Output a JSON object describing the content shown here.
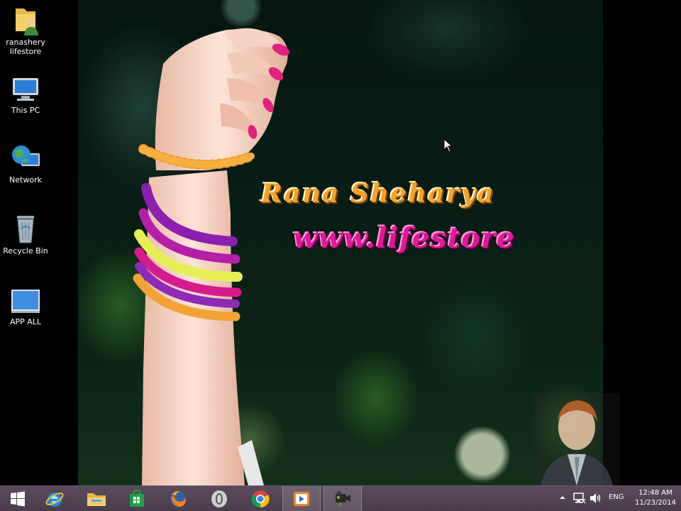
{
  "desktop": {
    "icons": [
      {
        "label": "ranashery\nlifestore",
        "icon": "user-folder-icon"
      },
      {
        "label": "This PC",
        "icon": "computer-icon"
      },
      {
        "label": "Network",
        "icon": "network-globe-icon"
      },
      {
        "label": "Recycle Bin",
        "icon": "recycle-bin-icon"
      },
      {
        "label": "APP ALL",
        "icon": "monitor-shortcut-icon"
      }
    ],
    "wallpaper": {
      "line1": "Rana Sheharya",
      "line2": "www.lifestore"
    }
  },
  "taskbar": {
    "buttons": [
      {
        "name": "start",
        "icon": "windows-logo-icon"
      },
      {
        "name": "internet-explorer",
        "icon": "ie-icon"
      },
      {
        "name": "file-explorer",
        "icon": "folder-icon"
      },
      {
        "name": "store",
        "icon": "store-bag-icon"
      },
      {
        "name": "firefox",
        "icon": "firefox-icon"
      },
      {
        "name": "opera",
        "icon": "opera-icon"
      },
      {
        "name": "chrome",
        "icon": "chrome-icon"
      },
      {
        "name": "media-player",
        "icon": "media-player-icon",
        "active": true
      },
      {
        "name": "camtasia-recorder",
        "icon": "camera-icon",
        "active": true
      }
    ],
    "tray": {
      "language": "ENG",
      "time": "12:48 AM",
      "date": "11/23/2014"
    }
  },
  "colors": {
    "taskbar": "#4b3d4d",
    "wallpaper_name": "#f4a326",
    "wallpaper_site": "#e0189a"
  }
}
